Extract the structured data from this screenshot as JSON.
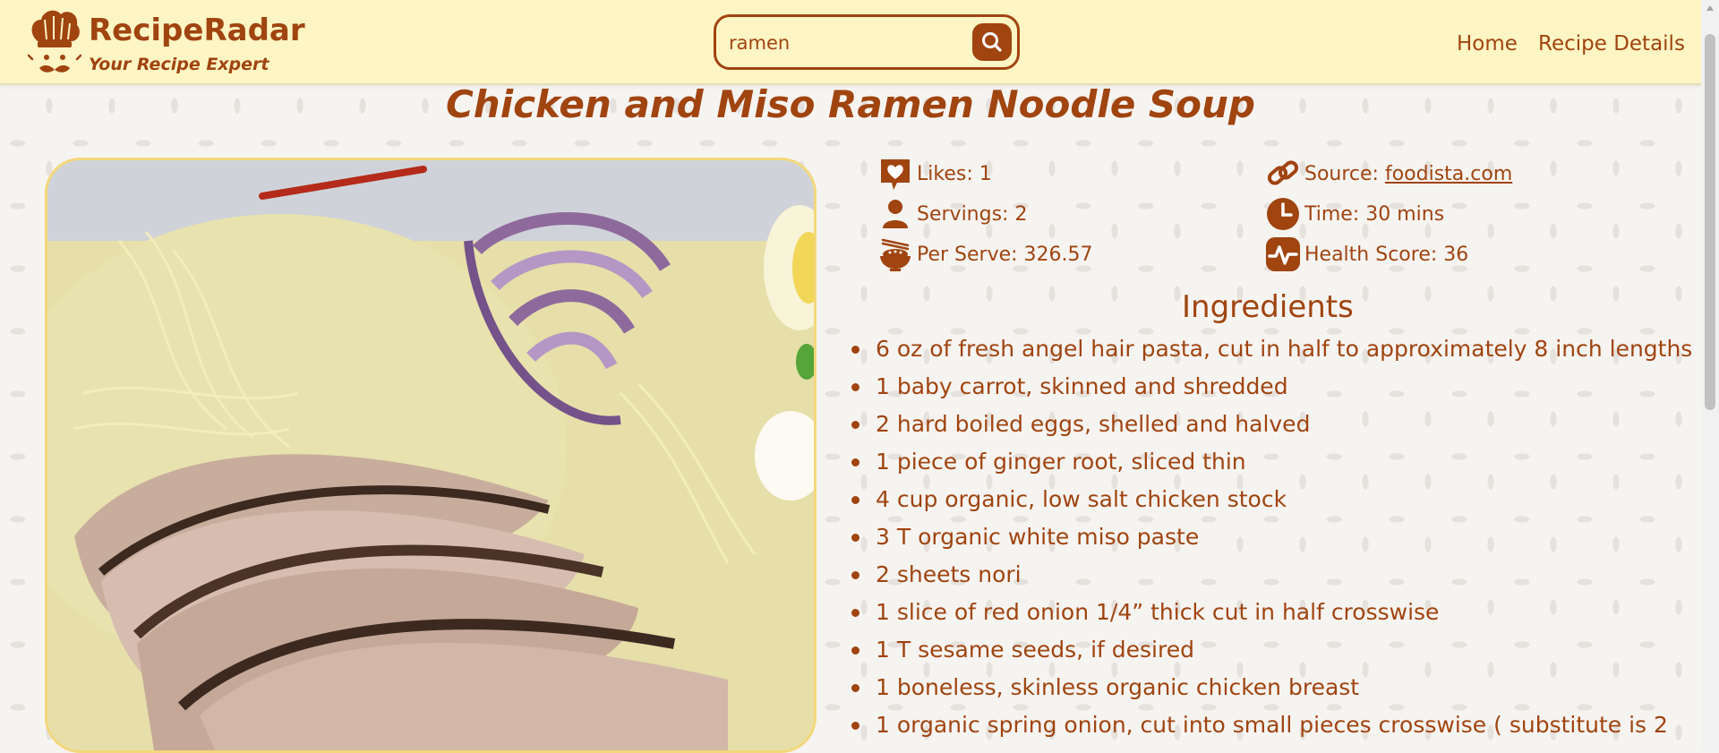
{
  "brand": {
    "name": "RecipeRadar",
    "tagline": "Your Recipe Expert",
    "icon": "chef-hat-icon"
  },
  "search": {
    "value": "ramen",
    "placeholder": "",
    "button_icon": "search-icon"
  },
  "nav": {
    "home": "Home",
    "recipe_details": "Recipe Details"
  },
  "recipe": {
    "title": "Chicken and Miso Ramen Noodle Soup",
    "image_alt": "Chicken and Miso Ramen Noodle Soup",
    "stats": {
      "likes": "Likes: 1",
      "source_prefix": "Source: ",
      "source_link": "foodista.com",
      "servings": "Servings: 2",
      "time": "Time: 30 mins",
      "per_serve": "Per Serve: 326.57",
      "health_score": "Health Score: 36"
    },
    "ingredients_title": "Ingredients",
    "ingredients": [
      "6 oz of fresh angel hair pasta, cut in half to approximately 8 inch lengths",
      "1 baby carrot, skinned and shredded",
      "2 hard boiled eggs, shelled and halved",
      "1 piece of ginger root, sliced thin",
      "4 cup organic, low salt chicken stock",
      "3 T organic white miso paste",
      "2 sheets nori",
      "1 slice of red onion 1/4” thick cut in half crosswise",
      "1 T sesame seeds, if desired",
      "1 boneless, skinless organic chicken breast",
      "1 organic spring onion, cut into small pieces crosswise ( substitute is 2"
    ]
  },
  "colors": {
    "accent": "#a04410",
    "header_bg": "#fdf5c3",
    "photo_border": "#f3d77a"
  }
}
